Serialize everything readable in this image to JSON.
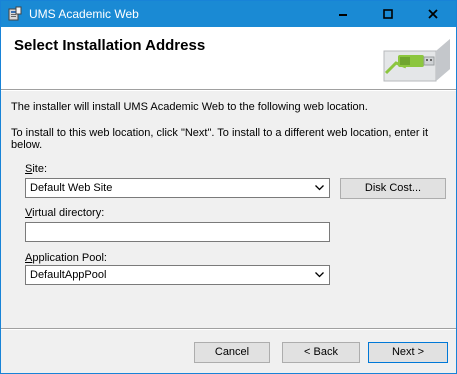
{
  "window": {
    "title": "UMS Academic Web",
    "colors": {
      "titlebar": "#1a8ad4",
      "close_button": "#c42b1c"
    }
  },
  "header": {
    "title": "Select Installation Address"
  },
  "body": {
    "line1": "The installer will install UMS Academic Web to the following web location.",
    "line2": "To install to this web location, click \"Next\". To install to a different web location, enter it below."
  },
  "site": {
    "label_key": "S",
    "label_rest": "ite:",
    "value": "Default Web Site",
    "disk_cost_label": "Disk Cost..."
  },
  "virtual_directory": {
    "label_key": "V",
    "label_rest": "irtual directory:",
    "value": ""
  },
  "app_pool": {
    "label_key": "A",
    "label_rest": "pplication Pool:",
    "value": "DefaultAppPool"
  },
  "footer": {
    "cancel_label": "Cancel",
    "back_label": "< Back",
    "next_label": "Next >"
  }
}
